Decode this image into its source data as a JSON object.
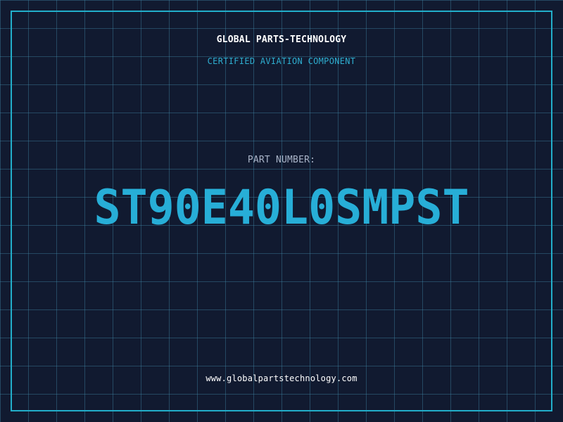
{
  "header": {
    "company_name": "GLOBAL PARTS-TECHNOLOGY",
    "tagline": "CERTIFIED AVIATION COMPONENT"
  },
  "part": {
    "label": "PART NUMBER:",
    "number": "ST90E40L0SMPST"
  },
  "footer": {
    "website": "www.globalpartstechnology.com"
  },
  "colors": {
    "background": "#111a30",
    "grid": "#4089a8",
    "frame": "#22aeca",
    "accent": "#27aed7",
    "title_text": "#ffffff",
    "label_text": "#a9b4c8"
  }
}
